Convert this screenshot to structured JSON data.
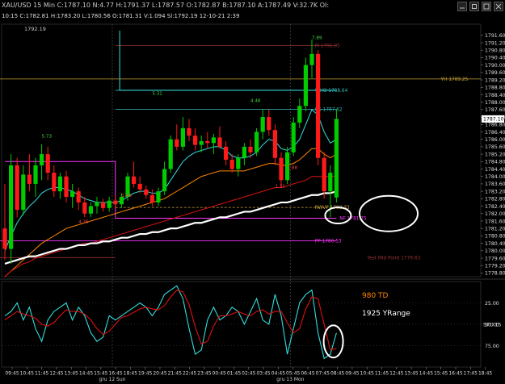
{
  "window": {
    "title": "XAU/USD 15 Min C:1787.10 N:4.77 H:1791.37 L:1787.57 O:1782.87 B:1787.10 A:1787.49 V:32.7K OI:",
    "info": "10:15 C:1782.81 H:1783.20 L:1780.56 O:1781.31 V:1.094 Sl:1792.19 12-10-21 2:39"
  },
  "colors": {
    "background": "#000000",
    "bull": "#00cc00",
    "bear": "#ff1a1a",
    "cyan": "#33dddd",
    "orange": "#ff8800",
    "red_ma": "#dd1111",
    "white_ma": "#ffffff",
    "magenta": "#ff33ff",
    "hline_red": "#993333",
    "hline_gold": "#c9a13a",
    "hline_cyan": "#33bbbb"
  },
  "chart_data": [
    {
      "type": "candlestick",
      "price_label_top_left": "1792.19",
      "y_ticks": [
        "1791.60",
        "1791.20",
        "1790.80",
        "1790.40",
        "1790.00",
        "1789.60",
        "1789.20",
        "1788.80",
        "1788.40",
        "1788.00",
        "1787.60",
        "1787.20",
        "1786.80",
        "1786.40",
        "1786.00",
        "1785.60",
        "1785.20",
        "1784.80",
        "1784.40",
        "1784.00",
        "1783.60",
        "1783.20",
        "1782.80",
        "1782.40",
        "1782.00",
        "1781.60",
        "1781.20",
        "1780.80",
        "1780.40",
        "1780.00",
        "1779.60",
        "1779.20",
        "1778.80"
      ],
      "ylim": [
        1778.6,
        1792.2
      ],
      "last_price_label": "1787.10",
      "candles": [
        {
          "o": 1781.2,
          "h": 1783.6,
          "l": 1779.5,
          "c": 1780.1
        },
        {
          "o": 1780.1,
          "h": 1785.2,
          "l": 1779.3,
          "c": 1784.6
        },
        {
          "o": 1784.6,
          "h": 1785.0,
          "l": 1781.8,
          "c": 1782.2
        },
        {
          "o": 1782.2,
          "h": 1784.6,
          "l": 1781.9,
          "c": 1784.1
        },
        {
          "o": 1784.1,
          "h": 1785.2,
          "l": 1783.2,
          "c": 1783.6
        },
        {
          "o": 1783.6,
          "h": 1785.0,
          "l": 1782.9,
          "c": 1784.6
        },
        {
          "o": 1784.6,
          "h": 1785.73,
          "l": 1783.8,
          "c": 1785.2
        },
        {
          "o": 1785.2,
          "h": 1785.6,
          "l": 1783.8,
          "c": 1784.2
        },
        {
          "o": 1784.2,
          "h": 1784.6,
          "l": 1782.9,
          "c": 1783.2
        },
        {
          "o": 1783.2,
          "h": 1784.2,
          "l": 1782.8,
          "c": 1784.0
        },
        {
          "o": 1784.0,
          "h": 1784.3,
          "l": 1782.6,
          "c": 1782.9
        },
        {
          "o": 1782.9,
          "h": 1783.6,
          "l": 1782.3,
          "c": 1783.2
        },
        {
          "o": 1783.2,
          "h": 1783.4,
          "l": 1782.2,
          "c": 1782.6
        },
        {
          "o": 1782.6,
          "h": 1782.9,
          "l": 1781.8,
          "c": 1782.0
        },
        {
          "o": 1782.0,
          "h": 1782.6,
          "l": 1781.8,
          "c": 1782.4
        },
        {
          "o": 1782.4,
          "h": 1782.9,
          "l": 1782.0,
          "c": 1782.6
        },
        {
          "o": 1782.6,
          "h": 1782.8,
          "l": 1782.1,
          "c": 1782.3
        },
        {
          "o": 1782.3,
          "h": 1782.9,
          "l": 1782.1,
          "c": 1782.7
        },
        {
          "o": 1782.7,
          "h": 1783.0,
          "l": 1782.3,
          "c": 1782.5
        },
        {
          "o": 1782.5,
          "h": 1783.1,
          "l": 1782.3,
          "c": 1782.9
        },
        {
          "o": 1782.9,
          "h": 1784.2,
          "l": 1782.7,
          "c": 1784.0
        },
        {
          "o": 1784.0,
          "h": 1784.8,
          "l": 1783.4,
          "c": 1783.6
        },
        {
          "o": 1783.6,
          "h": 1784.0,
          "l": 1783.1,
          "c": 1783.3
        },
        {
          "o": 1783.3,
          "h": 1783.5,
          "l": 1782.8,
          "c": 1783.0
        },
        {
          "o": 1783.0,
          "h": 1783.3,
          "l": 1782.4,
          "c": 1782.6
        },
        {
          "o": 1782.6,
          "h": 1783.4,
          "l": 1782.4,
          "c": 1783.2
        },
        {
          "o": 1783.2,
          "h": 1784.8,
          "l": 1783.0,
          "c": 1784.4
        },
        {
          "o": 1784.4,
          "h": 1786.2,
          "l": 1784.2,
          "c": 1786.0
        },
        {
          "o": 1786.0,
          "h": 1786.8,
          "l": 1785.4,
          "c": 1785.6
        },
        {
          "o": 1785.6,
          "h": 1787.2,
          "l": 1785.4,
          "c": 1786.6
        },
        {
          "o": 1786.6,
          "h": 1787.1,
          "l": 1785.9,
          "c": 1786.2
        },
        {
          "o": 1786.2,
          "h": 1786.6,
          "l": 1785.4,
          "c": 1785.7
        },
        {
          "o": 1785.7,
          "h": 1786.2,
          "l": 1785.3,
          "c": 1785.9
        },
        {
          "o": 1785.9,
          "h": 1786.4,
          "l": 1785.5,
          "c": 1785.8
        },
        {
          "o": 1785.8,
          "h": 1786.3,
          "l": 1785.2,
          "c": 1786.1
        },
        {
          "o": 1786.1,
          "h": 1786.7,
          "l": 1785.5,
          "c": 1785.6
        },
        {
          "o": 1785.6,
          "h": 1785.9,
          "l": 1784.6,
          "c": 1784.9
        },
        {
          "o": 1784.9,
          "h": 1785.2,
          "l": 1784.2,
          "c": 1784.4
        },
        {
          "o": 1784.4,
          "h": 1785.2,
          "l": 1784.0,
          "c": 1785.0
        },
        {
          "o": 1785.0,
          "h": 1785.8,
          "l": 1784.6,
          "c": 1785.6
        },
        {
          "o": 1785.6,
          "h": 1786.0,
          "l": 1785.0,
          "c": 1785.3
        },
        {
          "o": 1785.3,
          "h": 1786.6,
          "l": 1785.1,
          "c": 1786.4
        },
        {
          "o": 1786.4,
          "h": 1787.6,
          "l": 1786.0,
          "c": 1787.2
        },
        {
          "o": 1787.2,
          "h": 1787.6,
          "l": 1786.2,
          "c": 1786.5
        },
        {
          "o": 1786.5,
          "h": 1786.8,
          "l": 1784.6,
          "c": 1785.0
        },
        {
          "o": 1785.0,
          "h": 1785.3,
          "l": 1783.4,
          "c": 1783.8
        },
        {
          "o": 1783.8,
          "h": 1785.6,
          "l": 1783.6,
          "c": 1785.3
        },
        {
          "o": 1785.3,
          "h": 1787.2,
          "l": 1785.1,
          "c": 1786.9
        },
        {
          "o": 1786.9,
          "h": 1788.2,
          "l": 1786.6,
          "c": 1787.8
        },
        {
          "o": 1787.8,
          "h": 1790.4,
          "l": 1787.5,
          "c": 1790.0
        },
        {
          "o": 1790.0,
          "h": 1791.37,
          "l": 1789.3,
          "c": 1790.6
        },
        {
          "o": 1790.6,
          "h": 1790.8,
          "l": 1784.6,
          "c": 1785.0
        },
        {
          "o": 1785.0,
          "h": 1785.3,
          "l": 1782.8,
          "c": 1783.2
        },
        {
          "o": 1783.2,
          "h": 1784.6,
          "l": 1781.8,
          "c": 1784.2
        },
        {
          "o": 1782.87,
          "h": 1787.6,
          "l": 1782.6,
          "c": 1787.1
        }
      ],
      "moving_averages": [
        {
          "name": "cyan",
          "values": [
            1780.0,
            1780.8,
            1781.5,
            1782.0,
            1782.4,
            1782.7,
            1783.1,
            1783.3,
            1783.4,
            1783.4,
            1783.3,
            1783.2,
            1783.0,
            1782.8,
            1782.7,
            1782.6,
            1782.6,
            1782.6,
            1782.6,
            1782.7,
            1782.9,
            1783.1,
            1783.2,
            1783.2,
            1783.1,
            1783.1,
            1783.3,
            1783.8,
            1784.3,
            1784.8,
            1785.1,
            1785.3,
            1785.4,
            1785.5,
            1785.6,
            1785.6,
            1785.4,
            1785.1,
            1785.0,
            1785.0,
            1785.1,
            1785.3,
            1785.7,
            1786.0,
            1785.9,
            1785.5,
            1785.4,
            1785.6,
            1786.0,
            1786.8,
            1787.6,
            1787.3,
            1786.4,
            1785.8,
            1786.0
          ]
        },
        {
          "name": "orange",
          "values": [
            1778.6,
            1778.9,
            1779.2,
            1779.5,
            1779.8,
            1780.1,
            1780.4,
            1780.6,
            1780.8,
            1781.0,
            1781.2,
            1781.3,
            1781.4,
            1781.5,
            1781.6,
            1781.7,
            1781.8,
            1781.9,
            1782.0,
            1782.1,
            1782.2,
            1782.3,
            1782.4,
            1782.5,
            1782.6,
            1782.7,
            1782.8,
            1783.0,
            1783.2,
            1783.4,
            1783.6,
            1783.8,
            1784.0,
            1784.1,
            1784.2,
            1784.3,
            1784.3,
            1784.3,
            1784.3,
            1784.3,
            1784.4,
            1784.5,
            1784.6,
            1784.7,
            1784.7,
            1784.6,
            1784.6,
            1784.7,
            1784.9,
            1785.2,
            1785.5,
            1785.5,
            1785.2,
            1785.0,
            1785.2
          ]
        },
        {
          "name": "red",
          "values": [
            1778.6,
            1778.9,
            1779.1,
            1779.3,
            1779.4,
            1779.6,
            1779.7,
            1779.8,
            1779.9,
            1780.0,
            1780.1,
            1780.2,
            1780.3,
            1780.4,
            1780.4,
            1780.5,
            1780.6,
            1780.7,
            1780.8,
            1780.9,
            1781.0,
            1781.1,
            1781.2,
            1781.3,
            1781.4,
            1781.5,
            1781.6,
            1781.7,
            1781.8,
            1781.9,
            1782.0,
            1782.1,
            1782.2,
            1782.3,
            1782.4,
            1782.5,
            1782.6,
            1782.7,
            1782.8,
            1782.9,
            1783.0,
            1783.1,
            1783.2,
            1783.3,
            1783.4,
            1783.4,
            1783.5,
            1783.6,
            1783.7,
            1783.8,
            1784.0,
            1784.0,
            1784.0,
            1784.0,
            1784.0
          ]
        },
        {
          "name": "white",
          "values": [
            1779.3,
            1779.4,
            1779.5,
            1779.6,
            1779.7,
            1779.7,
            1779.8,
            1779.9,
            1780.0,
            1780.1,
            1780.1,
            1780.2,
            1780.3,
            1780.3,
            1780.4,
            1780.4,
            1780.5,
            1780.5,
            1780.6,
            1780.7,
            1780.7,
            1780.8,
            1780.9,
            1780.9,
            1781.0,
            1781.0,
            1781.1,
            1781.2,
            1781.2,
            1781.3,
            1781.4,
            1781.5,
            1781.5,
            1781.6,
            1781.7,
            1781.8,
            1781.8,
            1781.9,
            1782.0,
            1782.1,
            1782.1,
            1782.2,
            1782.3,
            1782.4,
            1782.5,
            1782.6,
            1782.6,
            1782.7,
            1782.8,
            1782.9,
            1783.0,
            1783.0,
            1783.1,
            1783.1,
            1783.2
          ]
        }
      ],
      "horizontal_levels": [
        {
          "label": "PI 1791.05",
          "value": 1791.05,
          "color": "#993333"
        },
        {
          "label": "YH 1789.25",
          "value": 1789.25,
          "color": "#c9a13a"
        },
        {
          "label": "WHO 1788.64",
          "value": 1788.64,
          "color": "#33bbbb"
        },
        {
          "label": "HS 1787.62",
          "value": 1787.62,
          "color": "#33bbbb"
        },
        {
          "label": "RWVP 1782.33",
          "value": 1782.33,
          "color": "#c9a13a"
        },
        {
          "label": "NF 1781.75",
          "value": 1781.75,
          "color": "#ff33ff"
        },
        {
          "label": "PP 1780.53",
          "value": 1780.53,
          "color": "#ff33ff"
        },
        {
          "label": "Yest Mid Point 1779.63",
          "value": 1779.63,
          "color": "#993333"
        }
      ],
      "swing_labels": [
        {
          "text": "5.73",
          "value": 1786.1
        },
        {
          "text": "4.36",
          "value": 1781.5
        },
        {
          "text": "5.31",
          "value": 1788.4
        },
        {
          "text": "1.43",
          "value": 1782.9
        },
        {
          "text": "4.48",
          "value": 1788.0
        },
        {
          "text": "1.31",
          "value": 1783.4
        },
        {
          "text": "7.89",
          "value": 1791.4
        },
        {
          "text": "1.88",
          "value": 1784.4
        }
      ]
    },
    {
      "type": "line",
      "name": "STO 15",
      "ylim": [
        100,
        0
      ],
      "y_ticks": [
        "25.00",
        "50.00",
        "75.00"
      ],
      "annotations": [
        "980 TD",
        "1925 YRange"
      ],
      "series": [
        {
          "name": "%K",
          "values": [
            40,
            35,
            25,
            45,
            30,
            55,
            70,
            45,
            35,
            30,
            25,
            45,
            30,
            40,
            60,
            70,
            65,
            40,
            45,
            40,
            35,
            30,
            25,
            30,
            40,
            30,
            15,
            10,
            5,
            20,
            55,
            85,
            80,
            45,
            30,
            45,
            40,
            30,
            35,
            50,
            35,
            20,
            45,
            50,
            15,
            40,
            85,
            55,
            25,
            15,
            10,
            60,
            90,
            85,
            60
          ]
        },
        {
          "name": "%D",
          "values": [
            45,
            40,
            35,
            38,
            40,
            43,
            50,
            52,
            48,
            40,
            33,
            35,
            35,
            38,
            45,
            55,
            62,
            58,
            50,
            42,
            40,
            36,
            32,
            30,
            32,
            33,
            28,
            18,
            10,
            12,
            27,
            53,
            73,
            70,
            52,
            40,
            40,
            38,
            35,
            38,
            40,
            35,
            33,
            38,
            35,
            35,
            48,
            60,
            55,
            32,
            18,
            20,
            50,
            80,
            78
          ]
        }
      ]
    }
  ],
  "time_axis": [
    "09:45",
    "10:45",
    "11:45",
    "12:45",
    "13:45",
    "14:45",
    "15:45",
    "16:45",
    "18:45",
    "19:45",
    "20:45",
    "21:45",
    "22:45",
    "23:45",
    "00:45",
    "01:45",
    "02:45",
    "03:45",
    "04:45",
    "05:45",
    "06:45",
    "07:45",
    "08:45",
    "09:45",
    "10:45",
    "11:45",
    "12:45",
    "13:45",
    "14:45",
    "15:45",
    "16:45",
    "17:45",
    "18:45"
  ],
  "date_labels": [
    "gru 12 Sun",
    "gru 13 Mon"
  ]
}
